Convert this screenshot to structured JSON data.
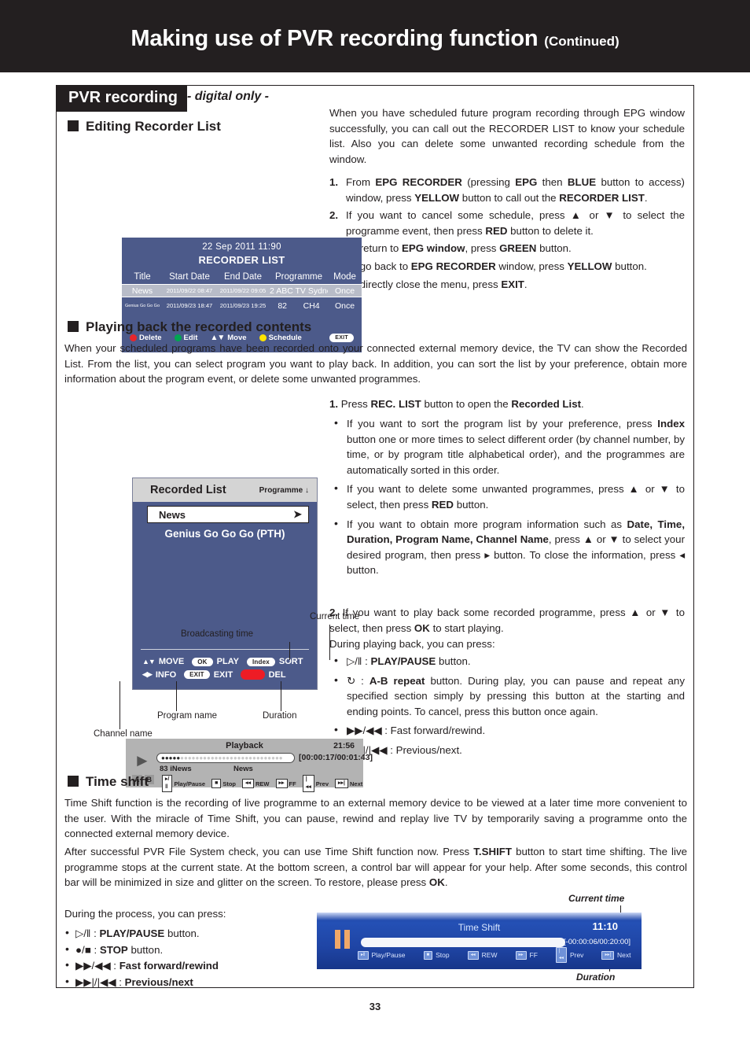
{
  "header": {
    "title": "Making use of PVR recording function",
    "continued": "(Continued)"
  },
  "section_tag": {
    "label": "PVR recording",
    "subtitle": "- digital only -"
  },
  "sections": {
    "editing_recorder_list": {
      "heading": "Editing Recorder List",
      "intro": "When you have scheduled future program recording through EPG window successfully, you can call out the RECORDER LIST to know your schedule list. Also you can delete some unwanted recording schedule from the window.",
      "steps": [
        {
          "marker": "1.",
          "html": "From <b>EPG RECORDER</b> (pressing <b>EPG</b> then <b>BLUE</b> button to access) window, press <b>YELLOW</b> button to call out the <b>RECORDER LIST</b>."
        },
        {
          "marker": "2.",
          "html": "If you want to cancel some schedule, press &#9650; or &#9660; to select the programme event, then press <b>RED</b> button to delete it."
        },
        {
          "marker": "3.",
          "html": "To return to <b>EPG window</b>, press <b>GREEN</b> button."
        }
      ],
      "step3_extra": [
        "To go back to <b>EPG RECORDER</b> window, press <b>YELLOW</b> button.",
        "To directly close the menu, press <b>EXIT</b>."
      ]
    },
    "playing_back": {
      "heading": "Playing back the recorded contents",
      "intro": "When your scheduled programs have been recorded onto your connected external memory device, the TV can show the Recorded List. From the list, you can select program you want to play back. In addition, you can sort the list by your preference, obtain more information about the program event, or delete some unwanted programmes.",
      "step1": "<b>1.</b> Press <b>REC. LIST</b> button to open the <b>Recorded List</b>.",
      "bullets": [
        "If you want to sort the program list by your preference, press <b>Index</b> button one or more times to select different order (by channel number, by time, or by program title alphabetical order), and the programmes are automatically sorted in this order.",
        "If you want to delete some unwanted programmes, press &#9650; or &#9660; to select, then press <b>RED</b> button.",
        "If you want to obtain more program information such as <b>Date, Time, Duration, Program Name, Channel Name</b>, press &#9650; or &#9660; to select your desired program, then press &#9656; button. To close the information, press &#9666; button."
      ],
      "step2": "<b>2.</b> If you want to play back some recorded programme, press &#9650; or &#9660; to select, then press <b>OK</b> to start playing.",
      "during_label": "During playing back, you can press:",
      "during_bullets": [
        "&#9655;/&#8214; : <b>PLAY/PAUSE</b> button.",
        "&#8635; : <b>A-B repeat</b> button. During play, you can pause and repeat any specified section simply by pressing this button at the starting and ending points. To cancel, press this button once again.",
        "&#9654;&#9654;/&#9664;&#9664; : Fast forward/rewind.",
        "&#9654;&#9654;|/|&#9664;&#9664; : Previous/next."
      ]
    },
    "time_shift": {
      "heading": "Time shift",
      "para1": "Time Shift function is the recording of live programme to an external memory device to be viewed at a later time more convenient to the user. With the miracle of Time Shift, you can pause, rewind and replay live TV by temporarily saving a programme onto the connected external memory device.",
      "para2": "After successful PVR File System check, you can use Time Shift function now. Press <b>T.SHIFT</b> button to start time shifting. The live programme stops at the current state. At the bottom screen, a control bar will appear for your help. After some seconds, this control bar will be minimized in size and glitter on the screen. To restore, please press <b>OK</b>.",
      "during_label": "During the process, you can press:",
      "bullets": [
        "&#9655;/&#8214; : <b>PLAY/PAUSE</b> button.",
        "&#9679;/&#9632; : <b>STOP</b> button.",
        "&#9654;&#9654;/&#9664;&#9664; : <b>Fast forward/rewind</b>",
        "&#9654;&#9654;|/|&#9664;&#9664; : <b>Previous/next</b>"
      ]
    }
  },
  "recorder_list_osd": {
    "date": "22 Sep 2011  11:90",
    "title": "RECORDER LIST",
    "columns": [
      "Title",
      "Start Date",
      "End Date",
      "Programme",
      "Mode"
    ],
    "rows": [
      {
        "title": "News",
        "start": "2011/09/22 08:47",
        "end": "2011/09/22 09:05",
        "prog_num": "2",
        "prog_name": "ABC TV Sydney",
        "mode": "Once",
        "selected": true
      },
      {
        "title": "Genius Go Go Go",
        "start": "2011/09/23 18:47",
        "end": "2011/09/23 19:25",
        "prog_num": "82",
        "prog_name": "CH4",
        "mode": "Once",
        "selected": false
      }
    ],
    "footer": {
      "delete": "Delete",
      "edit": "Edit",
      "move": "Move",
      "schedule": "Schedule",
      "exit": "EXIT"
    }
  },
  "recorded_list_osd": {
    "title": "Recorded List",
    "sort_label": "Programme ↓",
    "items": [
      {
        "label": "News",
        "selected": true,
        "arrow": "➤"
      },
      {
        "label": "Genius Go Go Go (PTH)",
        "selected": false
      }
    ],
    "footer": [
      {
        "key": "ⒶⓍ",
        "label": "MOVE",
        "key2": "OK",
        "label2": "PLAY",
        "key3": "Index",
        "label3": "SORT"
      },
      {
        "key": "ⒶⓍ",
        "label": "INFO",
        "key2": "EXIT",
        "label2": "EXIT",
        "key3": "",
        "label3": "DEL"
      }
    ]
  },
  "playback_osd": {
    "title": "Playback",
    "current_time": "21:56",
    "duration": "[00:00:17/00:01:43]",
    "channel_name": "83 iNews",
    "program_name": "News",
    "ab_a": "A",
    "ab_b": "B",
    "keys": [
      {
        "icon": "▸/‖",
        "label": "Play/Pause"
      },
      {
        "icon": "■",
        "label": "Stop"
      },
      {
        "icon": "◂◂",
        "label": "REW"
      },
      {
        "icon": "▸▸",
        "label": "FF"
      },
      {
        "icon": "|◂◂",
        "label": "Prev"
      },
      {
        "icon": "▸▸|",
        "label": "Next"
      }
    ],
    "annotations": {
      "current_time": "Current time",
      "broadcasting_time": "Broadcasting time",
      "program_name": "Program name",
      "channel_name": "Channel name",
      "duration": "Duration"
    }
  },
  "timeshift_osd": {
    "title": "Time Shift",
    "current_time": "11:10",
    "duration": "[-00:00:06/00:20:00]",
    "keys": [
      {
        "icon": "▸‖",
        "label": "Play/Pause"
      },
      {
        "icon": "■",
        "label": "Stop"
      },
      {
        "icon": "◂◂",
        "label": "REW"
      },
      {
        "icon": "▸▸",
        "label": "FF"
      },
      {
        "icon": "|◂◂",
        "label": "Prev"
      },
      {
        "icon": "▸▸|",
        "label": "Next"
      }
    ],
    "annotations": {
      "current_time": "Current time",
      "duration": "Duration"
    }
  },
  "page_number": "33",
  "colors": {
    "osd_blue": "#4c5a8a",
    "timeshift_blue": "#2450b5",
    "red": "#ee1c25",
    "green": "#00a651",
    "yellow": "#ffe400",
    "dark": "#231f20"
  }
}
